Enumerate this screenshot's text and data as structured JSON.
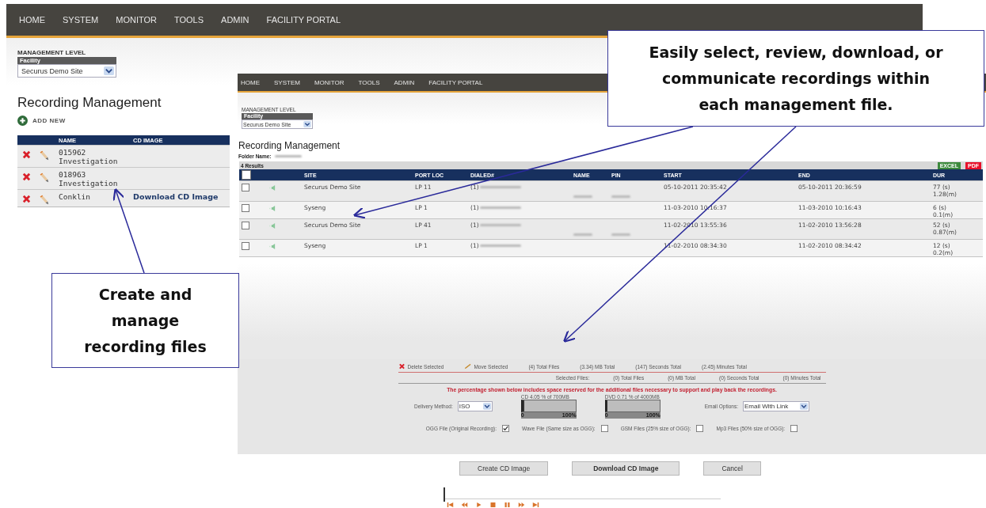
{
  "back_window": {
    "nav": [
      "HOME",
      "SYSTEM",
      "MONITOR",
      "TOOLS",
      "ADMIN",
      "FACILITY PORTAL"
    ],
    "management_level": {
      "label": "MANAGEMENT LEVEL",
      "sublabel": "Facility",
      "value": "Securus Demo Site"
    },
    "title": "Recording Management",
    "add_new": "ADD NEW",
    "table": {
      "columns": [
        "NAME",
        "CD IMAGE"
      ],
      "rows": [
        {
          "name": "015962 Investigation"
        },
        {
          "name": "018963 Investigation"
        },
        {
          "name": "Conklin",
          "cd_image": "Download CD Image"
        }
      ]
    }
  },
  "front_window": {
    "nav": [
      "HOME",
      "SYSTEM",
      "MONITOR",
      "TOOLS",
      "ADMIN",
      "FACILITY PORTAL"
    ],
    "management_level": {
      "label": "MANAGEMENT LEVEL",
      "sublabel": "Facility",
      "value": "Securus Demo Site"
    },
    "title": "Recording Management",
    "folder_label": "Folder Name:",
    "results": "4 Results",
    "export_buttons": [
      "EXCEL",
      "PDF"
    ],
    "table": {
      "select_all_checked": false,
      "columns": [
        "SITE",
        "PORT LOC",
        "DIALED#",
        "NAME",
        "PIN",
        "START",
        "END",
        "DUR"
      ],
      "rows": [
        {
          "selected": false,
          "site": "Securus Demo Site",
          "port_loc": "LP 11",
          "dialed": "(1)",
          "name_redacted": true,
          "pin_redacted": true,
          "start": "05-10-2011 20:35:42",
          "end": "05-10-2011 20:36:59",
          "dur_seconds": "77 (s)",
          "dur_minutes": "1.28(m)"
        },
        {
          "selected": false,
          "site": "Syseng",
          "port_loc": "LP 1",
          "dialed": "(1)",
          "name_redacted": false,
          "pin_redacted": false,
          "start": "11-03-2010 10:16:37",
          "end": "11-03-2010 10:16:43",
          "dur_seconds": "6 (s)",
          "dur_minutes": "0.1(m)"
        },
        {
          "selected": false,
          "site": "Securus Demo Site",
          "port_loc": "LP 41",
          "dialed": "(1)",
          "name_redacted": true,
          "pin_redacted": true,
          "start": "11-02-2010 13:55:36",
          "end": "11-02-2010 13:56:28",
          "dur_seconds": "52 (s)",
          "dur_minutes": "0.87(m)"
        },
        {
          "selected": false,
          "site": "Syseng",
          "port_loc": "LP 1",
          "dialed": "(1)",
          "name_redacted": false,
          "pin_redacted": false,
          "start": "11-02-2010 08:34:30",
          "end": "11-02-2010 08:34:42",
          "dur_seconds": "12 (s)",
          "dur_minutes": "0.2(m)"
        }
      ]
    },
    "summary": {
      "actions": [
        "Delete Selected",
        "Move Selected"
      ],
      "totals": [
        "(4) Total Files",
        "(3.34) MB Total",
        "(147) Seconds Total",
        "(2.45) Minutes Total"
      ],
      "selected_label": "Selected Files:",
      "selected_totals": [
        "(0) Total Files",
        "(0) MB Total",
        "(0) Seconds Total",
        "(0) Minutes Total"
      ],
      "notice": "The percentage shown below includes space reserved for the additional files necessary to support and play back the recordings.",
      "delivery": {
        "label": "Delivery Method:",
        "value": "ISO"
      },
      "meters": [
        {
          "caption": "CD 4.05 % of 700MB",
          "level": 0.0405,
          "min": "0",
          "max": "100%"
        },
        {
          "caption": "DVD 0.71 % of 4000MB",
          "level": 0.0071,
          "min": "0",
          "max": "100%"
        }
      ],
      "email": {
        "label": "Email Options:",
        "value": "Email With Link"
      },
      "formats": [
        {
          "label": "OGG File (Original Recording):",
          "checked": true
        },
        {
          "label": "Wave File (Same size as OGG):",
          "checked": false
        },
        {
          "label": "GSM Files (25% size of OGG):",
          "checked": false
        },
        {
          "label": "Mp3 Files (50% size of OGG):",
          "checked": false
        }
      ]
    },
    "buttons": [
      "Create CD Image",
      "Download CD Image",
      "Cancel"
    ],
    "player": {
      "level": 0
    }
  },
  "callouts": [
    {
      "text": "Easily select, review, download, or communicate recordings within each management file."
    },
    {
      "text": "Create and manage recording files"
    }
  ]
}
